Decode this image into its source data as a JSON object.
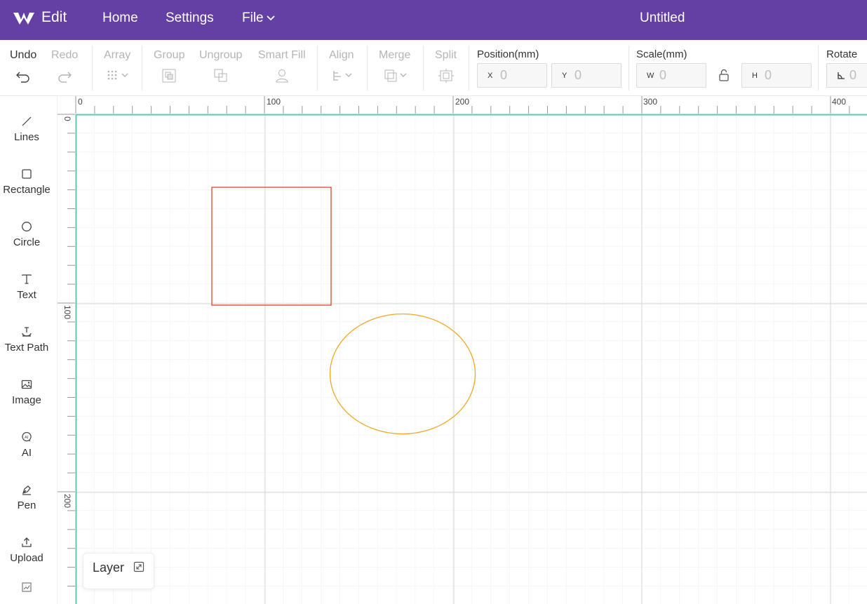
{
  "app": {
    "name": "Edit",
    "logo_icon": "w-logo-icon"
  },
  "nav": {
    "home": "Home",
    "settings": "Settings",
    "file": "File"
  },
  "document": {
    "title": "Untitled"
  },
  "toolbar": {
    "undo": "Undo",
    "redo": "Redo",
    "array": "Array",
    "group": "Group",
    "ungroup": "Ungroup",
    "smart_fill": "Smart Fill",
    "align": "Align",
    "merge": "Merge",
    "split": "Split",
    "position": {
      "label": "Position(mm)",
      "x_prefix": "X",
      "x": "0",
      "y_prefix": "Y",
      "y": "0"
    },
    "scale": {
      "label": "Scale(mm)",
      "w_prefix": "W",
      "w": "0",
      "h_prefix": "H",
      "h": "0"
    },
    "rotate": {
      "label": "Rotate",
      "value": "0"
    }
  },
  "sidebar": {
    "items": [
      {
        "label": "Lines",
        "icon": "line-icon"
      },
      {
        "label": "Rectangle",
        "icon": "rectangle-icon"
      },
      {
        "label": "Circle",
        "icon": "circle-icon"
      },
      {
        "label": "Text",
        "icon": "text-icon"
      },
      {
        "label": "Text Path",
        "icon": "text-path-icon"
      },
      {
        "label": "Image",
        "icon": "image-icon"
      },
      {
        "label": "AI",
        "icon": "ai-icon"
      },
      {
        "label": "Pen",
        "icon": "pen-icon"
      },
      {
        "label": "Upload",
        "icon": "upload-icon"
      }
    ]
  },
  "canvas": {
    "ruler_labels": [
      "0",
      "100",
      "200",
      "300",
      "400"
    ],
    "ruler_v_labels": [
      "0",
      "100",
      "200"
    ],
    "shapes": [
      {
        "type": "rectangle",
        "stroke": "#d9472b"
      },
      {
        "type": "ellipse",
        "stroke": "#f0a825"
      }
    ],
    "colors": {
      "grid_minor": "#efefef",
      "grid_major": "#dcdcdc",
      "origin_axis": "#5ec6b4",
      "brand": "#6440a5"
    }
  },
  "layer_panel": {
    "label": "Layer"
  }
}
